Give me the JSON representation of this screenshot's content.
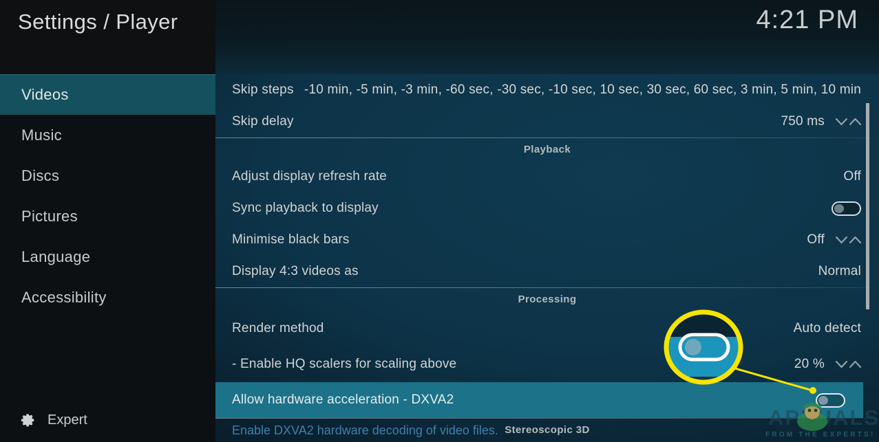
{
  "header": {
    "title": "Settings / Player",
    "clock": "4:21 PM"
  },
  "sidebar": {
    "items": [
      {
        "label": "Videos",
        "selected": true
      },
      {
        "label": "Music",
        "selected": false
      },
      {
        "label": "Discs",
        "selected": false
      },
      {
        "label": "Pictures",
        "selected": false
      },
      {
        "label": "Language",
        "selected": false
      },
      {
        "label": "Accessibility",
        "selected": false
      }
    ],
    "level_button": {
      "label": "Expert",
      "icon": "gear-icon"
    }
  },
  "settings": {
    "rows": [
      {
        "label": "Skip steps",
        "value": "-10 min, -5 min, -3 min, -60 sec, -30 sec, -10 sec, 10 sec, 30 sec, 60 sec, 3 min, 5 min, 10 min"
      },
      {
        "label": "Skip delay",
        "value": "750 ms"
      },
      {
        "label": "Adjust display refresh rate",
        "value": "Off"
      },
      {
        "label": "Sync playback to display",
        "value": ""
      },
      {
        "label": "Minimise black bars",
        "value": "Off"
      },
      {
        "label": "Display 4:3 videos as",
        "value": "Normal"
      },
      {
        "label": "Render method",
        "value": "Auto detect"
      },
      {
        "label": "- Enable HQ scalers for scaling above",
        "value": "20 %"
      },
      {
        "label": "Allow hardware acceleration - DXVA2",
        "value": ""
      }
    ],
    "sections": [
      {
        "label": "Playback"
      },
      {
        "label": "Processing"
      },
      {
        "label": "Stereoscopic 3D"
      }
    ],
    "description": "Enable DXVA2 hardware decoding of video files."
  },
  "annotation": {
    "color": "#f5e400",
    "shape": "ellipse-callout",
    "target": "dxva2-toggle"
  },
  "watermark": {
    "brand": "APPUALS",
    "tagline": "FROM THE EXPERTS!"
  },
  "colors": {
    "accent_selected": "#1b7289",
    "sidebar_selected": "#15505f",
    "background": "#0d3348",
    "description_text": "#3e7fa8",
    "annotation": "#f5e400"
  }
}
